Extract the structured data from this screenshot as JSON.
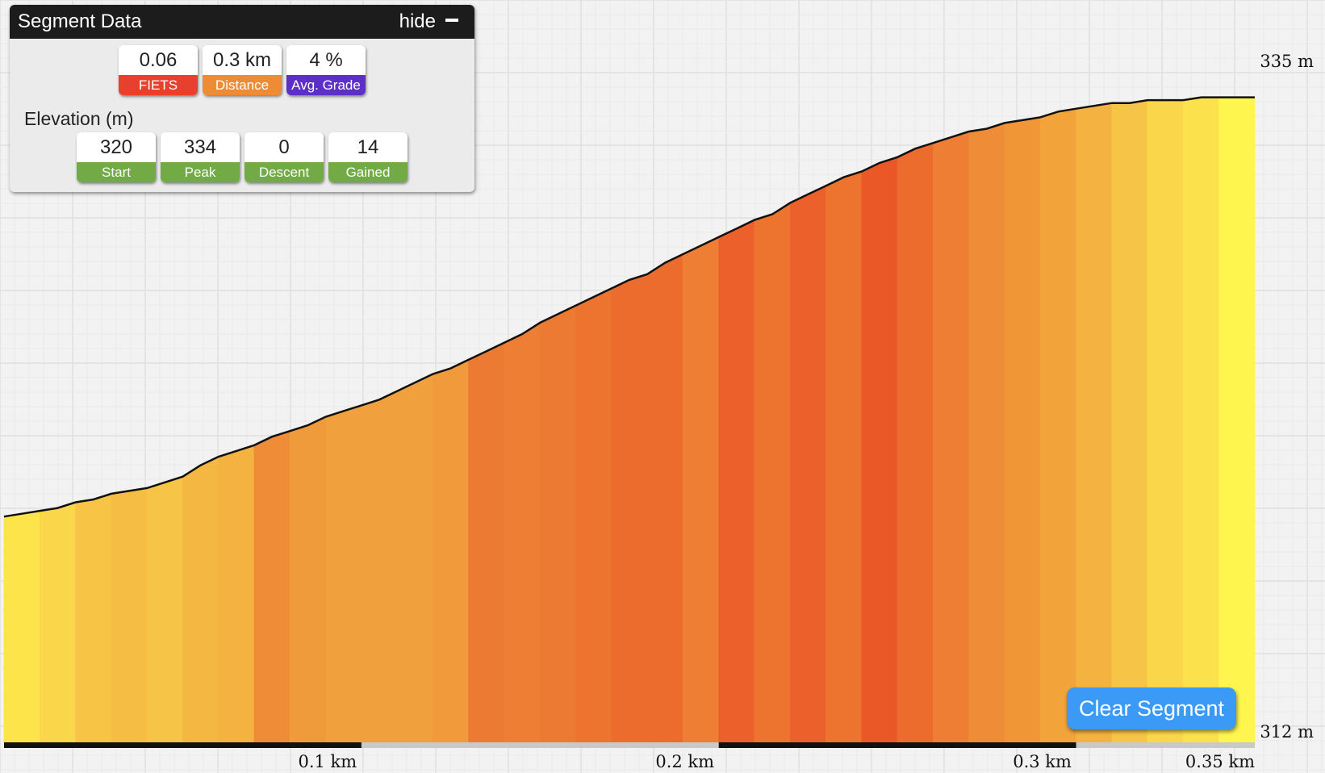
{
  "segment_panel": {
    "title": "Segment Data",
    "hide_label": "hide",
    "stats": [
      {
        "value": "0.06",
        "label": "FIETS",
        "color": "#e8402e"
      },
      {
        "value": "0.3 km",
        "label": "Distance",
        "color": "#ee8c35"
      },
      {
        "value": "4 %",
        "label": "Avg. Grade",
        "color": "#5c2fc7"
      }
    ],
    "elevation_heading": "Elevation (m)",
    "elevation_stats": [
      {
        "value": "320",
        "label": "Start",
        "color": "#72ab45"
      },
      {
        "value": "334",
        "label": "Peak",
        "color": "#72ab45"
      },
      {
        "value": "0",
        "label": "Descent",
        "color": "#72ab45"
      },
      {
        "value": "14",
        "label": "Gained",
        "color": "#72ab45"
      }
    ]
  },
  "clear_segment_label": "Clear Segment",
  "chart_data": {
    "type": "area",
    "title": "",
    "xlabel": "",
    "ylabel": "",
    "xlim": [
      0,
      0.35
    ],
    "ylim": [
      312,
      335
    ],
    "y_tick_labels": [
      "335 m",
      "312 m"
    ],
    "x_tick_labels": [
      "0.1 km",
      "0.2 km",
      "0.3 km",
      "0.35 km"
    ],
    "x_ticks": [
      0.1,
      0.2,
      0.3,
      0.35
    ],
    "selected_ranges": [
      [
        0,
        0.1
      ],
      [
        0.2,
        0.3
      ]
    ],
    "grid": true,
    "series": [
      {
        "x": [
          0,
          0.005,
          0.01,
          0.015,
          0.02,
          0.025,
          0.03,
          0.035,
          0.04,
          0.045,
          0.05,
          0.055,
          0.06,
          0.065,
          0.07,
          0.075,
          0.08,
          0.085,
          0.09,
          0.095,
          0.1,
          0.105,
          0.11,
          0.115,
          0.12,
          0.125,
          0.13,
          0.135,
          0.14,
          0.145,
          0.15,
          0.155,
          0.16,
          0.165,
          0.17,
          0.175,
          0.18,
          0.185,
          0.19,
          0.195,
          0.2,
          0.205,
          0.21,
          0.215,
          0.22,
          0.225,
          0.23,
          0.235,
          0.24,
          0.245,
          0.25,
          0.255,
          0.26,
          0.265,
          0.27,
          0.275,
          0.28,
          0.285,
          0.29,
          0.295,
          0.3,
          0.305,
          0.31,
          0.315,
          0.32,
          0.325,
          0.33,
          0.335,
          0.34,
          0.345,
          0.35
        ],
        "y": [
          320.0,
          320.1,
          320.2,
          320.3,
          320.5,
          320.6,
          320.8,
          320.9,
          321.0,
          321.2,
          321.4,
          321.8,
          322.1,
          322.3,
          322.5,
          322.8,
          323.0,
          323.2,
          323.5,
          323.7,
          323.9,
          324.1,
          324.4,
          324.7,
          325.0,
          325.2,
          325.5,
          325.8,
          326.1,
          326.4,
          326.8,
          327.1,
          327.4,
          327.7,
          328.0,
          328.3,
          328.5,
          328.9,
          329.2,
          329.5,
          329.8,
          330.1,
          330.4,
          330.6,
          331.0,
          331.3,
          331.6,
          331.9,
          332.1,
          332.4,
          332.6,
          332.9,
          333.1,
          333.3,
          333.5,
          333.6,
          333.8,
          333.9,
          334.0,
          334.2,
          334.3,
          334.4,
          334.5,
          334.5,
          334.6,
          334.6,
          334.6,
          334.7,
          334.7,
          334.7,
          334.7
        ]
      }
    ],
    "band_colors": [
      "#fce44a",
      "#fad64a",
      "#f7c446",
      "#f6bd44",
      "#f6c446",
      "#f4b842",
      "#f4b340",
      "#ef8c37",
      "#f09b3b",
      "#f0a03c",
      "#f0a03c",
      "#f0a03c",
      "#f09a3b",
      "#ed7a33",
      "#ee7e33",
      "#ed7a33",
      "#ed742f",
      "#ec6c2e",
      "#ec6c2e",
      "#ee7e33",
      "#ec602c",
      "#ed742f",
      "#ec602c",
      "#ed742f",
      "#ea5828",
      "#ec6c2e",
      "#ee7e33",
      "#ef8c37",
      "#f09636",
      "#f2a33a",
      "#f4b340",
      "#f6c446",
      "#fad64a",
      "#fbe24c",
      "#fef54f"
    ]
  }
}
